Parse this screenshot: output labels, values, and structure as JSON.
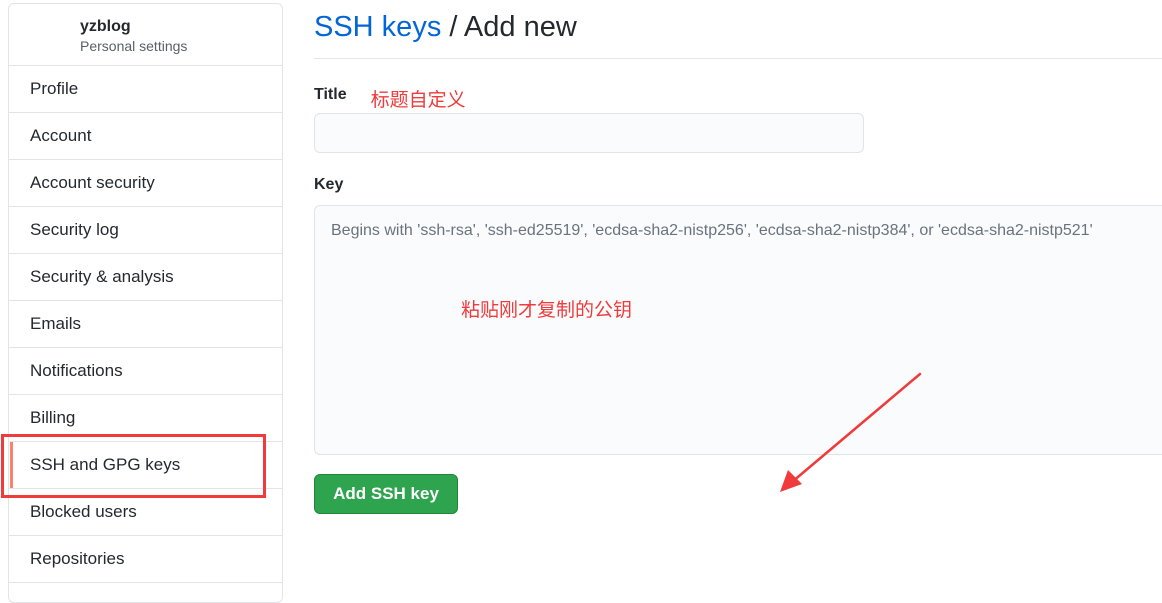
{
  "sidebar": {
    "user": "yzblog",
    "subtitle": "Personal settings",
    "items": [
      {
        "label": "Profile"
      },
      {
        "label": "Account"
      },
      {
        "label": "Account security"
      },
      {
        "label": "Security log"
      },
      {
        "label": "Security & analysis"
      },
      {
        "label": "Emails"
      },
      {
        "label": "Notifications"
      },
      {
        "label": "Billing"
      },
      {
        "label": "SSH and GPG keys",
        "selected": true
      },
      {
        "label": "Blocked users"
      },
      {
        "label": "Repositories"
      }
    ]
  },
  "main": {
    "breadcrumb_link": "SSH keys",
    "breadcrumb_sep": " / ",
    "breadcrumb_current": "Add new",
    "title_label": "Title",
    "title_value": "",
    "key_label": "Key",
    "key_placeholder": "Begins with 'ssh-rsa', 'ssh-ed25519', 'ecdsa-sha2-nistp256', 'ecdsa-sha2-nistp384', or 'ecdsa-sha2-nistp521'",
    "submit_label": "Add SSH key"
  },
  "annotations": {
    "title_note": "标题自定义",
    "key_note": "粘贴刚才复制的公钥",
    "color": "#ef3b3b"
  },
  "colors": {
    "link": "#0366d6",
    "primary_button": "#2ea44f",
    "selected_indicator": "#f9826c"
  }
}
